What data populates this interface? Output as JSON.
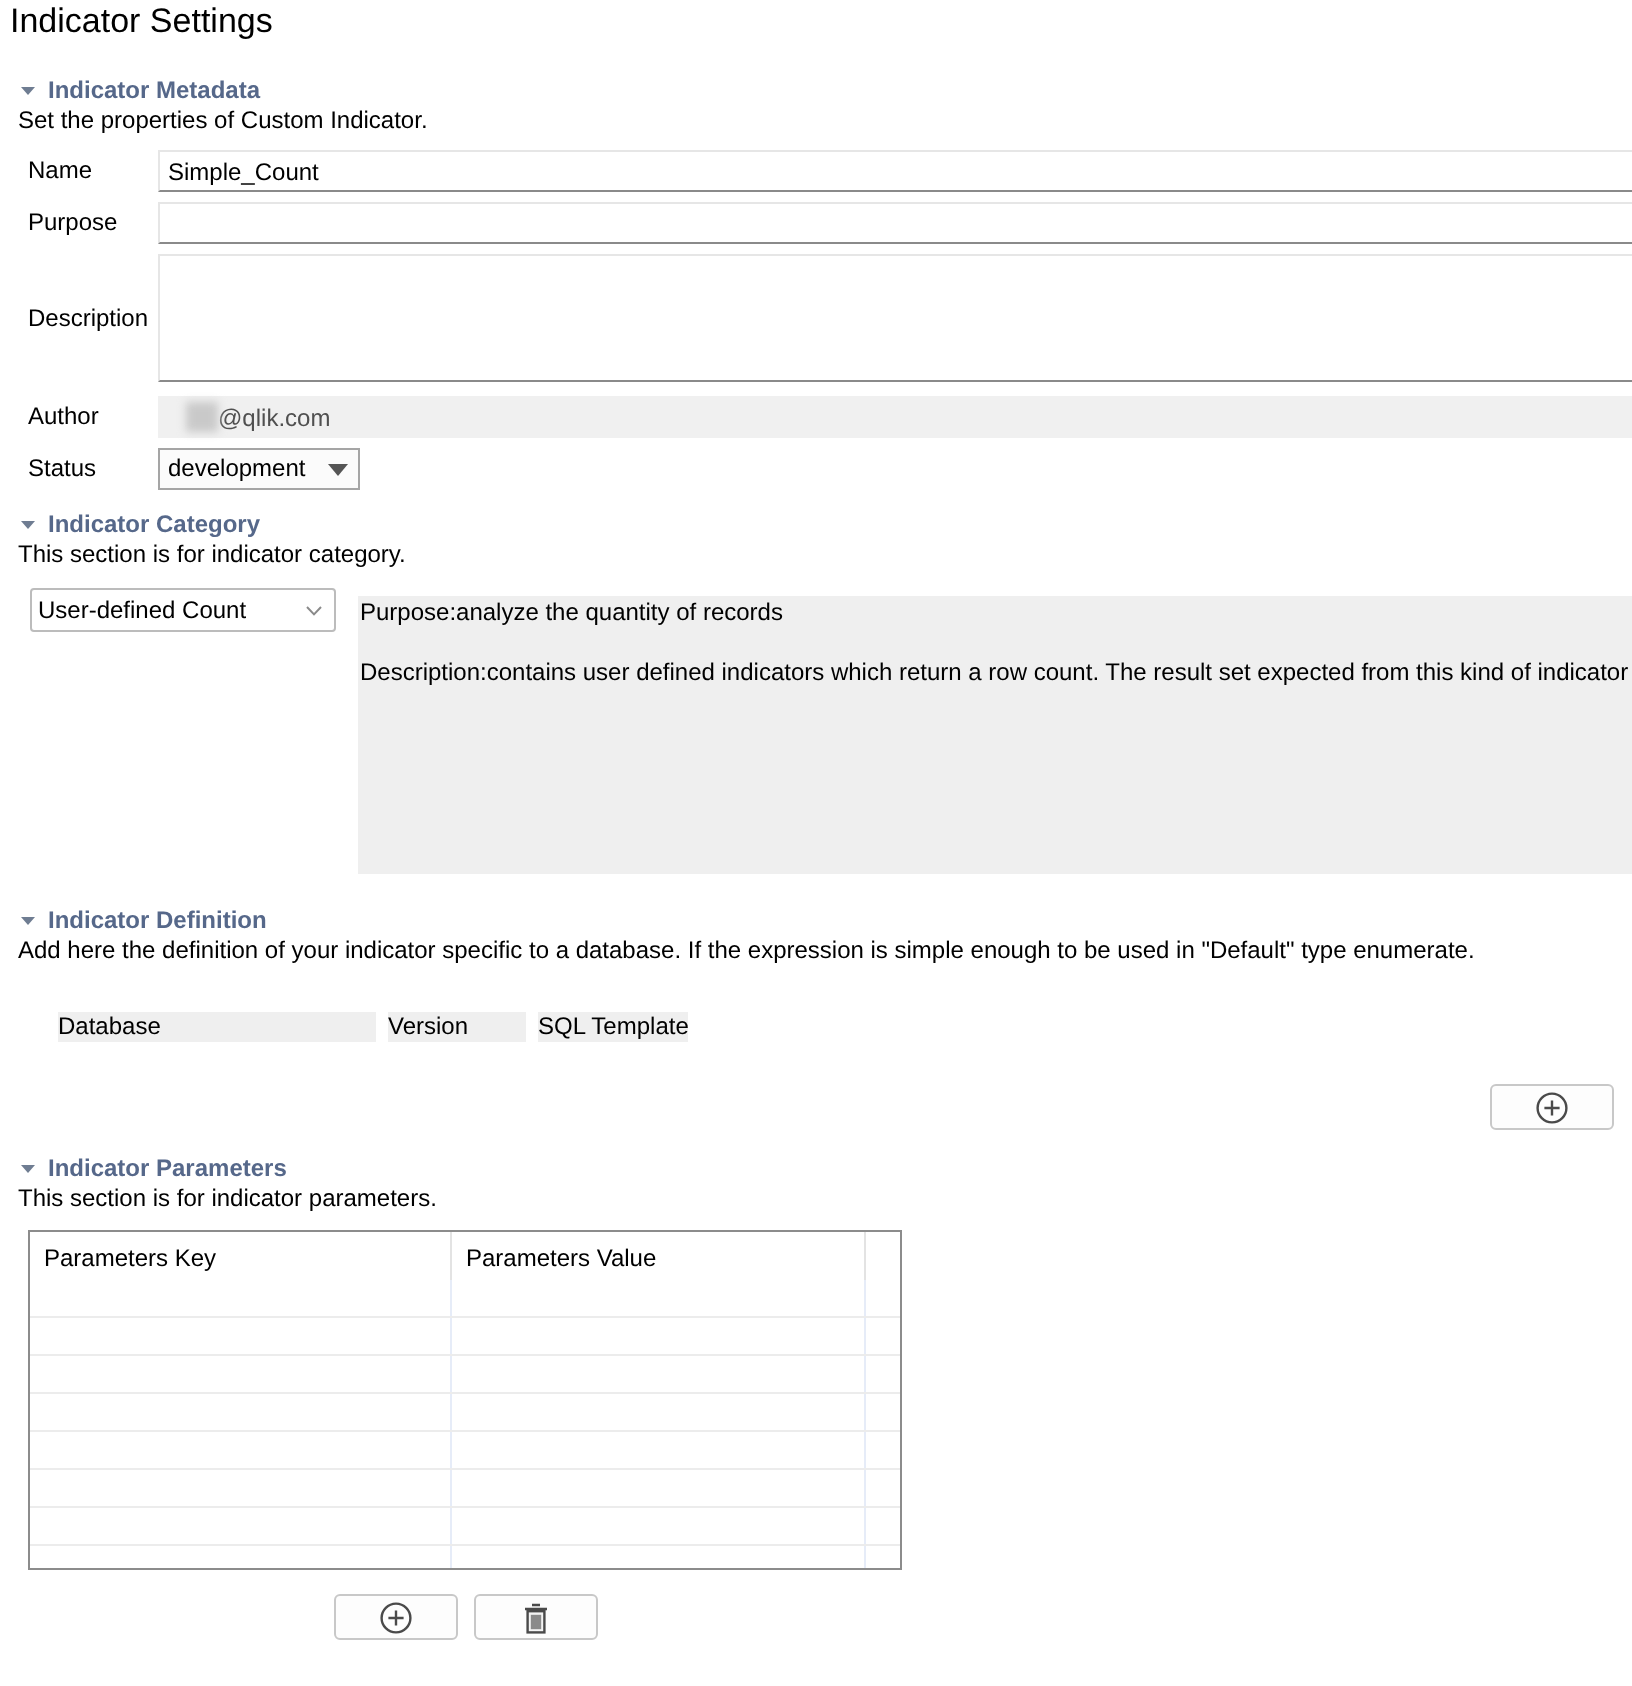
{
  "title": "Indicator Settings",
  "sections": [
    {
      "kind": "metadata",
      "title": "Indicator Metadata",
      "expanded": true,
      "description": "Set the properties of Custom Indicator.",
      "fields": [
        {
          "kind": "text",
          "label": "Name",
          "value": "Simple_Count"
        },
        {
          "kind": "text",
          "label": "Purpose"
        },
        {
          "kind": "textarea",
          "label": "Description"
        },
        {
          "kind": "readonly",
          "label": "Author",
          "value": "@qlik.com",
          "redacted": true
        },
        {
          "kind": "dropdown",
          "label": "Status",
          "value": "development"
        }
      ]
    },
    {
      "kind": "category",
      "title": "Indicator Category",
      "expanded": true,
      "description": "This section is for indicator category.",
      "category": "User-defined Count",
      "info_lines": [
        "Purpose:analyze the quantity of records",
        "Description:contains user defined indicators which return a row count. The result set expected from this kind of indicator"
      ]
    },
    {
      "kind": "definition",
      "title": "Indicator Definition",
      "expanded": true,
      "description": "Add here the definition of your indicator specific to a database. If the expression is simple enough to be used in \"Default\" type enumerate.",
      "columns": [
        "Database",
        "Version",
        "SQL Template"
      ],
      "buttons": [
        {
          "kind": "add"
        }
      ]
    },
    {
      "kind": "parameters",
      "title": "Indicator Parameters",
      "expanded": true,
      "description": "This section is for indicator parameters.",
      "columns": [
        "Parameters Key",
        "Parameters Value"
      ],
      "buttons": [
        {
          "kind": "add"
        },
        {
          "kind": "delete"
        }
      ]
    }
  ]
}
